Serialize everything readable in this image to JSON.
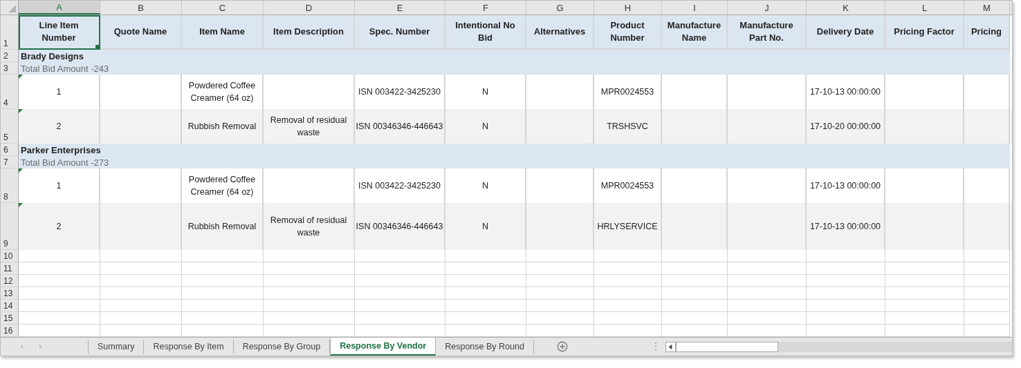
{
  "columns": [
    {
      "letter": "A",
      "selected": true
    },
    {
      "letter": "B",
      "selected": false
    },
    {
      "letter": "C",
      "selected": false
    },
    {
      "letter": "D",
      "selected": false
    },
    {
      "letter": "E",
      "selected": false
    },
    {
      "letter": "F",
      "selected": false
    },
    {
      "letter": "G",
      "selected": false
    },
    {
      "letter": "H",
      "selected": false
    },
    {
      "letter": "I",
      "selected": false
    },
    {
      "letter": "J",
      "selected": false
    },
    {
      "letter": "K",
      "selected": false
    },
    {
      "letter": "L",
      "selected": false
    },
    {
      "letter": "M",
      "selected": false
    }
  ],
  "header_row": {
    "row": "1",
    "cells": {
      "A": "Line Item Number",
      "B": "Quote Name",
      "C": "Item Name",
      "D": "Item Description",
      "E": "Spec. Number",
      "F": "Intentional No Bid",
      "G": "Alternatives",
      "H": "Product Number",
      "I": "Manufacture Name",
      "J": "Manufacture Part No.",
      "K": "Delivery Date",
      "L": "Pricing Factor",
      "M": "Pricing"
    }
  },
  "groups": [
    {
      "vendor_row": "2",
      "vendor": "Brady Designs",
      "total_row": "3",
      "total": "Total Bid Amount -243",
      "items": [
        {
          "row": "4",
          "number_as_text": true,
          "tall": false,
          "cells": {
            "A": "1",
            "C": "Powdered Coffee Creamer (64 oz)",
            "E": "ISN 003422-3425230",
            "F": "N",
            "H": "MPR0024553",
            "K": "17-10-13 00:00:00"
          }
        },
        {
          "row": "5",
          "number_as_text": true,
          "tall": false,
          "cells": {
            "A": "2",
            "C": "Rubbish Removal",
            "D": "Removal of residual waste",
            "E": "ISN 00346346-446643",
            "F": "N",
            "H": "TRSHSVC",
            "K": "17-10-20 00:00:00"
          }
        }
      ]
    },
    {
      "vendor_row": "6",
      "vendor": "Parker Enterprises",
      "total_row": "7",
      "total": "Total Bid Amount -273",
      "items": [
        {
          "row": "8",
          "number_as_text": true,
          "tall": false,
          "cells": {
            "A": "1",
            "C": "Powdered Coffee Creamer (64 oz)",
            "E": "ISN 003422-3425230",
            "F": "N",
            "H": "MPR0024553",
            "K": "17-10-13 00:00:00"
          }
        },
        {
          "row": "9",
          "number_as_text": true,
          "tall": true,
          "cells": {
            "A": "2",
            "C": "Rubbish Removal",
            "D": "Removal of residual waste",
            "E": "ISN 00346346-446643",
            "F": "N",
            "H": "HRLYSERVICE",
            "K": "17-10-13 00:00:00"
          }
        }
      ]
    }
  ],
  "empty_rows": [
    "10",
    "11",
    "12",
    "13",
    "14",
    "15",
    "16"
  ],
  "sheet_tabs": [
    {
      "label": "Summary",
      "selected": false
    },
    {
      "label": "Response By Item",
      "selected": false
    },
    {
      "label": "Response By Group",
      "selected": false
    },
    {
      "label": "Response By Vendor",
      "selected": true
    },
    {
      "label": "Response By Round",
      "selected": false
    }
  ]
}
